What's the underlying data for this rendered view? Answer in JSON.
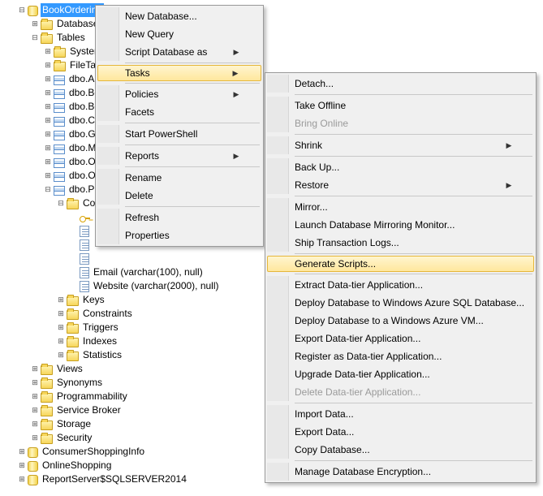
{
  "tree": {
    "db_selected": "BookOrdering",
    "database_diagrams": "Database D",
    "tables": "Tables",
    "system": "System",
    "filetab": "FileTab",
    "t1": "dbo.Au",
    "t2": "dbo.Bo",
    "t3": "dbo.Bo",
    "t4": "dbo.Cu",
    "t5": "dbo.Ge",
    "t6": "dbo.M",
    "t7": "dbo.Or",
    "t8": "dbo.Or",
    "t9": "dbo.Pu",
    "col_folder": "Col",
    "col_email": "Email (varchar(100), null)",
    "col_website": "Website (varchar(2000), null)",
    "keys": "Keys",
    "constraints": "Constraints",
    "triggers": "Triggers",
    "indexes": "Indexes",
    "statistics": "Statistics",
    "views": "Views",
    "synonyms": "Synonyms",
    "programmability": "Programmability",
    "service_broker": "Service Broker",
    "storage": "Storage",
    "security": "Security",
    "consumer": "ConsumerShoppingInfo",
    "onlineshopping": "OnlineShopping",
    "reportserver": "ReportServer$SQLSERVER2014"
  },
  "menu1": {
    "new_database": "New Database...",
    "new_query": "New Query",
    "script_db": "Script Database as",
    "tasks": "Tasks",
    "policies": "Policies",
    "facets": "Facets",
    "start_ps": "Start PowerShell",
    "reports": "Reports",
    "rename": "Rename",
    "delete": "Delete",
    "refresh": "Refresh",
    "properties": "Properties"
  },
  "menu2": {
    "detach": "Detach...",
    "take_offline": "Take Offline",
    "bring_online": "Bring Online",
    "shrink": "Shrink",
    "back_up": "Back Up...",
    "restore": "Restore",
    "mirror": "Mirror...",
    "launch_mirror": "Launch Database Mirroring Monitor...",
    "ship_logs": "Ship Transaction Logs...",
    "gen_scripts": "Generate Scripts...",
    "extract_dac": "Extract Data-tier Application...",
    "deploy_azure_db": "Deploy Database to Windows Azure SQL Database...",
    "deploy_azure_vm": "Deploy Database to a Windows Azure VM...",
    "export_dac": "Export Data-tier Application...",
    "register_dac": "Register as Data-tier Application...",
    "upgrade_dac": "Upgrade Data-tier Application...",
    "delete_dac": "Delete Data-tier Application...",
    "import_data": "Import Data...",
    "export_data": "Export Data...",
    "copy_db": "Copy Database...",
    "manage_enc": "Manage Database Encryption..."
  }
}
